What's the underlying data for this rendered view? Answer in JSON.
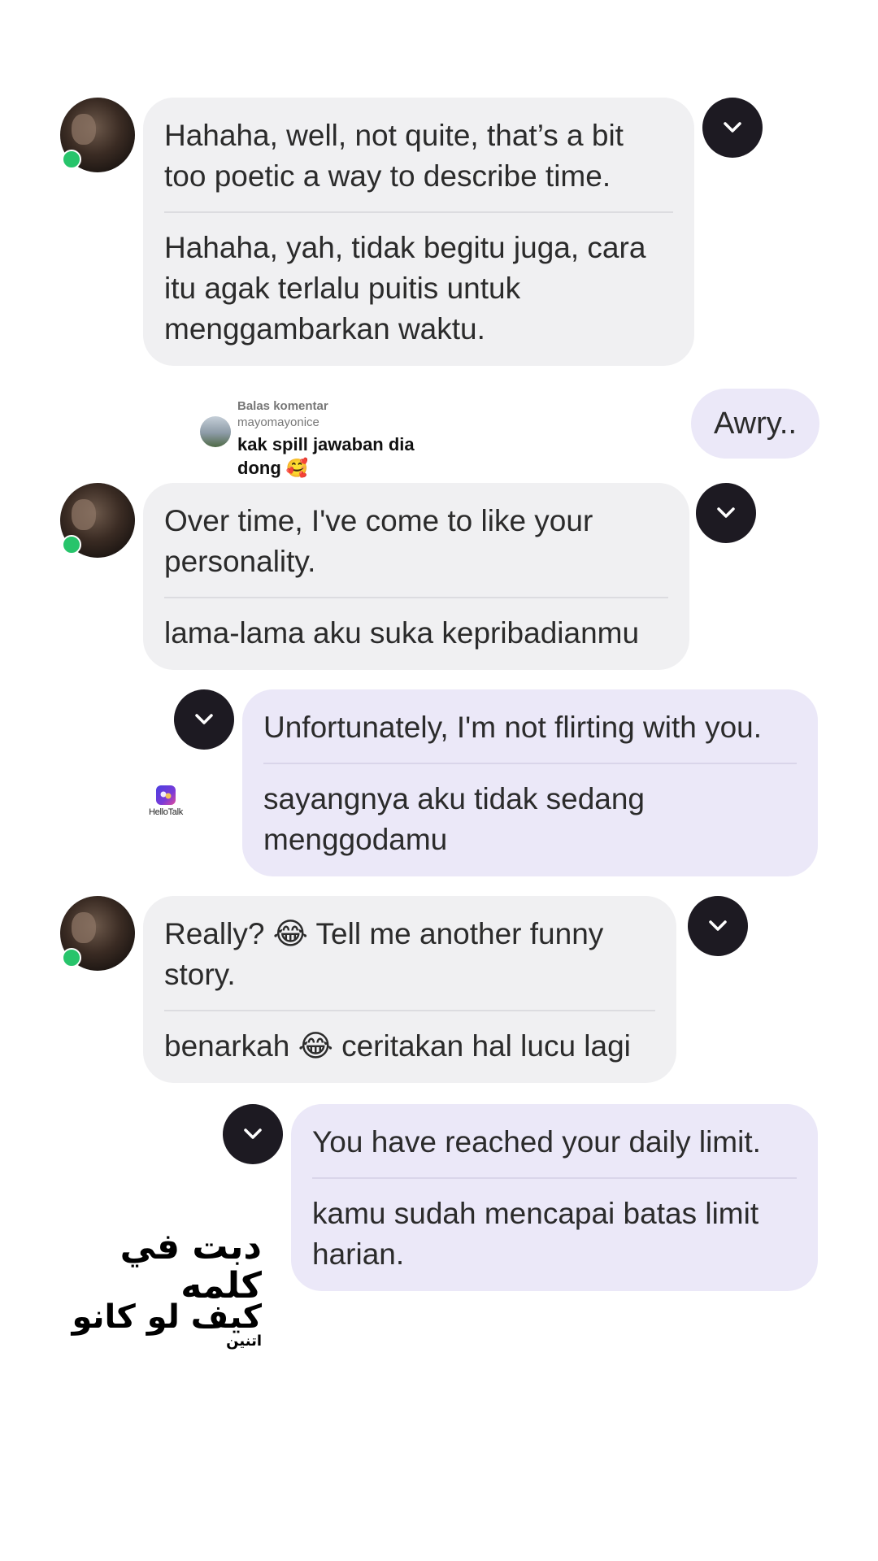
{
  "messages": [
    {
      "original": "Hahaha, well, not quite, that’s a bit too poetic a way to describe time.",
      "translation": "Hahaha, yah, tidak begitu juga, cara itu agak terlalu puitis untuk menggambarkan waktu."
    },
    {
      "original": "Awry.."
    },
    {
      "original": "Over time, I've come to like your personality.",
      "translation": "lama-lama aku suka kepribadianmu"
    },
    {
      "original": "Unfortunately, I'm not flirting with you.",
      "translation": "sayangnya aku tidak sedang menggodamu"
    },
    {
      "original": "Really? 😂 Tell me another funny story.",
      "translation": "benarkah 😂 ceritakan hal lucu lagi"
    },
    {
      "original": "You have reached your daily limit.",
      "translation": "kamu sudah mencapai batas limit harian."
    }
  ],
  "reply_card": {
    "label": "Balas komentar",
    "username": "mayomayonice",
    "text": "kak spill jawaban dia dong 🥰"
  },
  "watermark": {
    "app_name": "HelloTalk"
  },
  "overlay_text": {
    "line1": "دبت في كلمه",
    "line2": "كيف لو كانو",
    "line3": "اتنين"
  },
  "icons": {
    "expand": "chevron-down-icon",
    "online": "online-dot-icon"
  },
  "colors": {
    "incoming_bubble": "#f0f0f2",
    "outgoing_bubble": "#ebe8f8",
    "chevron_button": "#1d1a22",
    "online_status": "#27c46b"
  }
}
